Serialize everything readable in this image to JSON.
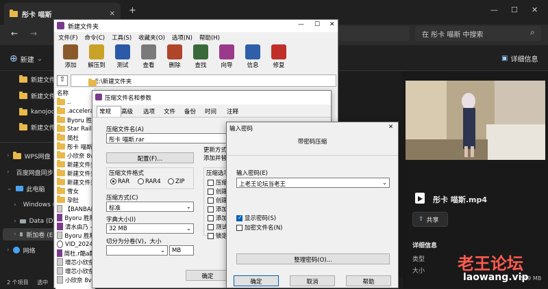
{
  "explorer": {
    "tab_title": "彤卡 喵斯",
    "search_placeholder": "在 彤卡 喵斯 中搜索",
    "new_label": "新建",
    "details_label": "详细信息",
    "sidebar": [
      {
        "label": "新建文件夹"
      },
      {
        "label": "新建文件夹"
      },
      {
        "label": "kanojodo"
      },
      {
        "label": "新建文件夹"
      },
      {
        "label": "WPS网盘"
      },
      {
        "label": "百度网盘同步空间"
      },
      {
        "label": "此电脑"
      },
      {
        "label": "Windows (C:)"
      },
      {
        "label": "Data (D:)"
      },
      {
        "label": "新加卷 (E:)"
      },
      {
        "label": "网络"
      }
    ],
    "status_count": "2 个项目",
    "status_selected": "选中",
    "preview": {
      "file_name": "彤卡 喵斯.mp4",
      "share_label": "共享",
      "details_heading": "详细信息",
      "type_label": "类型",
      "size_label": "大小",
      "size_value": "569 MB"
    }
  },
  "winrar": {
    "title": "新建文件夹",
    "menu": [
      "文件(F)",
      "命令(C)",
      "工具(S)",
      "收藏夹(O)",
      "选项(N)",
      "帮助(H)"
    ],
    "toolbar": [
      {
        "label": "添加",
        "icon": "add-icon",
        "color": "#8a5a2b"
      },
      {
        "label": "解压到",
        "icon": "extract-icon",
        "color": "#c9a227"
      },
      {
        "label": "测试",
        "icon": "test-icon",
        "color": "#2c59a8"
      },
      {
        "label": "查看",
        "icon": "view-icon",
        "color": "#7a7a7a"
      },
      {
        "label": "删除",
        "icon": "delete-icon",
        "color": "#b0452a"
      },
      {
        "label": "查找",
        "icon": "find-icon",
        "color": "#3a6a3a"
      },
      {
        "label": "向导",
        "icon": "wizard-icon",
        "color": "#9a3a8a"
      },
      {
        "label": "信息",
        "icon": "info-icon",
        "color": "#2f5fa8"
      },
      {
        "label": "修复",
        "icon": "repair-icon",
        "color": "#c0302a"
      }
    ],
    "path": "E:\\新建文件夹",
    "column_name": "名称",
    "files": [
      {
        "name": ".."
      },
      {
        "name": ".accelerate"
      },
      {
        "name": "Byoru 胜利"
      },
      {
        "name": "Star Rail"
      },
      {
        "name": "简杜"
      },
      {
        "name": "彤卡 喵斯"
      },
      {
        "name": "小欣奈 8v"
      },
      {
        "name": "新建文件夹"
      },
      {
        "name": "新建文件夹"
      },
      {
        "name": "新建文件夹"
      },
      {
        "name": "雪女"
      },
      {
        "name": "孕肚"
      },
      {
        "name": "【BANBAN"
      },
      {
        "name": "Byoru 胜利"
      },
      {
        "name": "清水由乃 -"
      },
      {
        "name": "Byoru 胜利"
      },
      {
        "name": "VID_2024"
      },
      {
        "name": "简杜.r酷a酷"
      },
      {
        "name": "壞芯小欣奈"
      },
      {
        "name": "壞芯小欣奈"
      },
      {
        "name": "小欣奈 8v"
      }
    ]
  },
  "archive_dialog": {
    "title": "压缩文件名和参数",
    "tabs": [
      "常规",
      "高级",
      "选项",
      "文件",
      "备份",
      "时间",
      "注释"
    ],
    "archive_name_label": "压缩文件名(A)",
    "archive_name_value": "彤卡 喵斯.rar",
    "profile_button": "配置(F)...",
    "update_mode_label": "更新方式",
    "update_mode_value": "添加并替",
    "format_label": "压缩文件格式",
    "formats": [
      "RAR",
      "RAR4",
      "ZIP"
    ],
    "method_label": "压缩方式(C)",
    "method_value": "标准",
    "dict_label": "字典大小(I)",
    "dict_value": "32 MB",
    "split_label": "切分为分卷(V)，大小",
    "split_unit": "MB",
    "options_label": "压缩选项",
    "options": [
      "压缩",
      "创建",
      "创建",
      "添加",
      "添加",
      "测试",
      "锁定"
    ],
    "ok_label": "确定"
  },
  "password_dialog": {
    "title": "输入密码",
    "heading": "带密码压缩",
    "password_label": "输入密码(E)",
    "password_value": "上老王论坛当老王",
    "show_password_label": "显示密码(S)",
    "show_password_checked": true,
    "encrypt_names_label": "加密文件名(N)",
    "encrypt_names_checked": false,
    "manage_button": "整理密码(O)...",
    "ok_label": "确定",
    "cancel_label": "取消",
    "help_label": "帮助"
  },
  "watermark": {
    "line1": "老王论坛",
    "line2": "laowang.vip"
  }
}
